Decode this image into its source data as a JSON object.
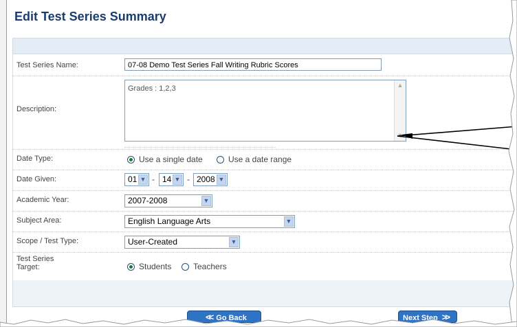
{
  "page": {
    "title": "Edit Test Series Summary"
  },
  "form": {
    "test_series_name": {
      "label": "Test Series Name:",
      "value": "07-08 Demo Test Series Fall Writing Rubric Scores"
    },
    "description": {
      "label": "Description:",
      "value": "Grades : 1,2,3"
    },
    "date_type": {
      "label": "Date Type:",
      "options": [
        "Use a single date",
        "Use a date range"
      ],
      "selected": "Use a single date"
    },
    "date_given": {
      "label": "Date Given:",
      "month": "01",
      "day": "14",
      "year": "2008",
      "separator": "-"
    },
    "academic_year": {
      "label": "Academic Year:",
      "value": "2007-2008"
    },
    "subject_area": {
      "label": "Subject Area:",
      "value": "English Language Arts"
    },
    "scope_test_type": {
      "label": "Scope / Test Type:",
      "value": "User-Created"
    },
    "test_series_target": {
      "label_line1": "Test Series",
      "label_line2": "Target:",
      "options": [
        "Students",
        "Teachers"
      ],
      "selected": "Students"
    }
  },
  "buttons": {
    "go_back": "Go Back",
    "next_step": "Next Step"
  },
  "icons": {
    "go_back": "double-chevron-left-icon",
    "next_step": "double-chevron-right-icon",
    "dropdown": "chevron-down-icon"
  },
  "colors": {
    "title": "#1a3c6e",
    "panel_header": "#e4edf6",
    "button": "#2f74c4",
    "radio_selected": "#1c7a34"
  }
}
